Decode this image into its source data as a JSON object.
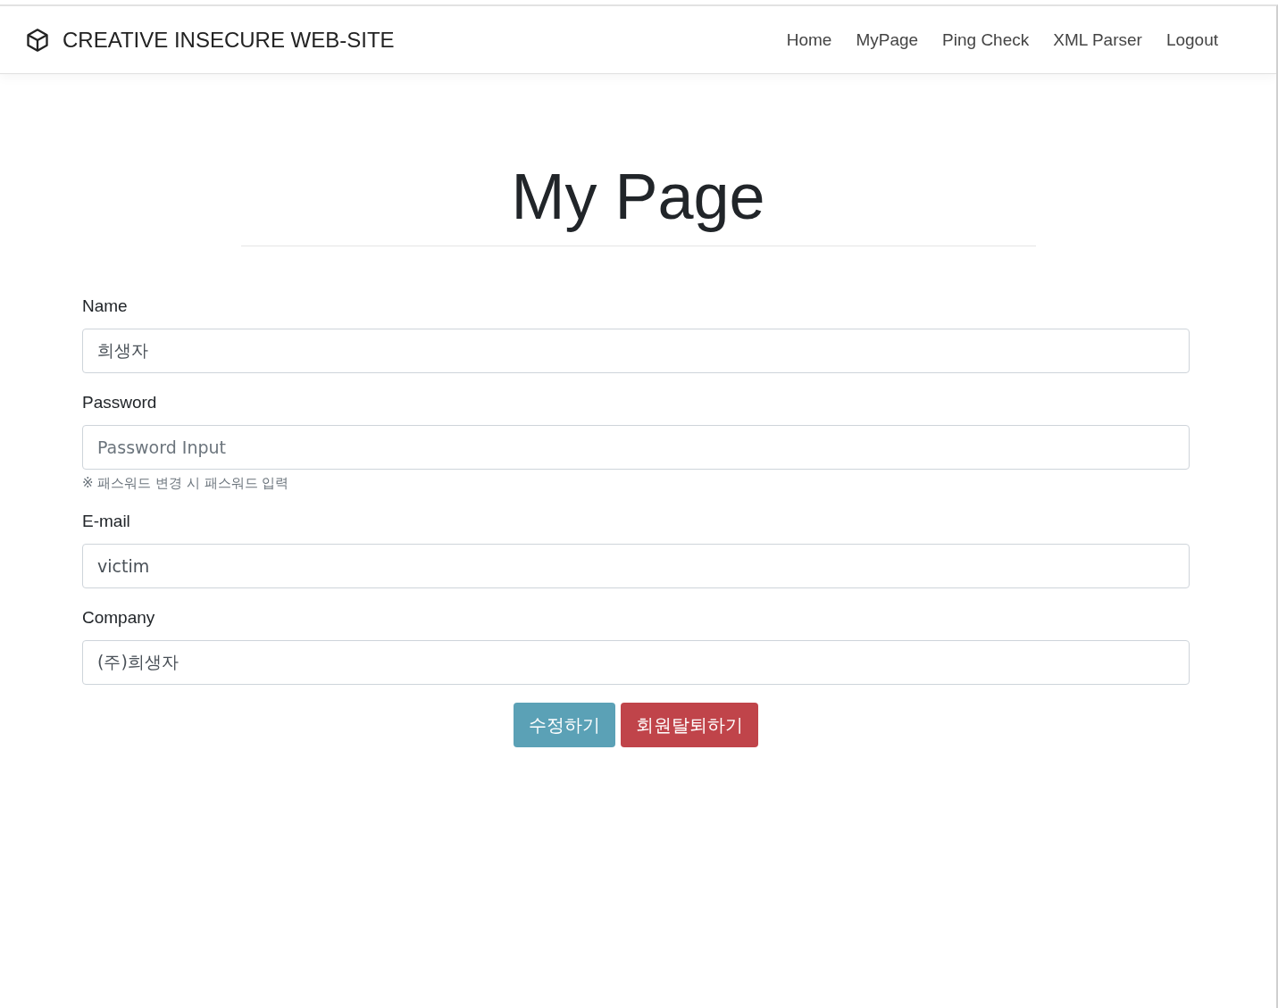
{
  "brand": {
    "title": "CREATIVE INSECURE WEB-SITE"
  },
  "nav": [
    {
      "label": "Home"
    },
    {
      "label": "MyPage"
    },
    {
      "label": "Ping Check"
    },
    {
      "label": "XML Parser"
    },
    {
      "label": "Logout"
    }
  ],
  "heading": "My Page",
  "fields": [
    {
      "label": "Name",
      "value": "희생자"
    },
    {
      "label": "Password",
      "placeholder": "Password Input",
      "help": "※ 패스워드 변경 시 패스워드 입력"
    },
    {
      "label": "E-mail",
      "value": "victim"
    },
    {
      "label": "Company",
      "value": "(주)희생자"
    }
  ],
  "buttons": [
    {
      "label": "수정하기",
      "kind": "info"
    },
    {
      "label": "회원탈퇴하기",
      "kind": "danger"
    }
  ]
}
